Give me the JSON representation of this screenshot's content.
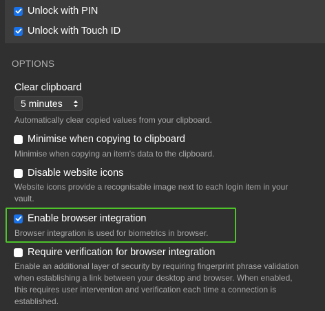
{
  "security": {
    "unlock_pin": {
      "label": "Unlock with PIN",
      "checked": true
    },
    "unlock_touch_id": {
      "label": "Unlock with Touch ID",
      "checked": true
    }
  },
  "options": {
    "section_title": "OPTIONS",
    "clear_clipboard": {
      "label": "Clear clipboard",
      "value": "5 minutes",
      "help": "Automatically clear copied values from your clipboard."
    },
    "minimise_copy": {
      "label": "Minimise when copying to clipboard",
      "checked": false,
      "help": "Minimise when copying an item's data to the clipboard."
    },
    "disable_icons": {
      "label": "Disable website icons",
      "checked": false,
      "help_line1": "Website icons provide a recognisable image next to each login item in your",
      "help_line2": "vault."
    },
    "browser_integration": {
      "label": "Enable browser integration",
      "checked": true,
      "help": "Browser integration is used for biometrics in browser."
    },
    "require_verification": {
      "label": "Require verification for browser integration",
      "checked": false,
      "help_line1": "Enable an additional layer of security by requiring fingerprint phrase validation",
      "help_line2": "when establishing a link between your desktop and browser. When enabled,",
      "help_line3": "this requires user intervention and verification each time a connection is",
      "help_line4": "established."
    }
  },
  "colors": {
    "background": "#303030",
    "panel": "#3d3d3d",
    "accent": "#1a72e8",
    "highlight": "#4ec32a"
  }
}
